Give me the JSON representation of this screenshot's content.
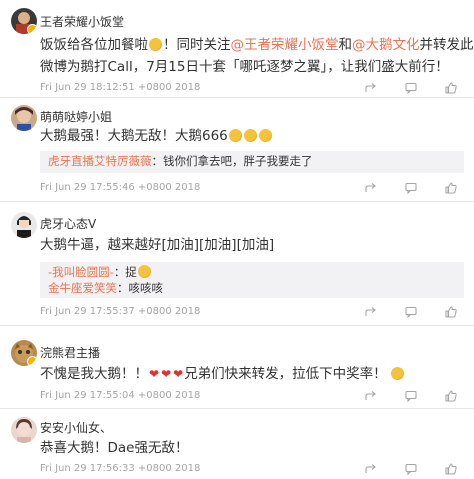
{
  "comments": [
    {
      "username": "王者荣耀小饭堂",
      "line1_a": "饭饭给各位加餐啦",
      "line1_b": "！同时关注",
      "mention1": "@王者荣耀小饭堂",
      "line1_c": "和",
      "mention2": "@大鹅文化",
      "line1_d": "并转发此",
      "line2": "微博为鹅打Call，7月15日十套「哪吒逐梦之翼」，让我们盛大前行！",
      "timestamp": "Fri Jun 29 18:12:51 +0800 2018"
    },
    {
      "username": "萌萌哒婷小姐",
      "content": "大鹅最强！大鹅无敌！大鹅666",
      "timestamp": "Fri Jun 29 17:55:46 +0800 2018",
      "replies": [
        {
          "user": "虎牙直播艾特厉薇薇",
          "text": "：钱你们拿去吧，胖子我要走了"
        }
      ]
    },
    {
      "username": "虎牙心态V",
      "content": "大鹅牛逼，越来越好[加油][加油][加油]",
      "timestamp": "Fri Jun 29 17:55:37 +0800 2018",
      "replies": [
        {
          "user": "-我叫脸圆圆-",
          "text": "：捉"
        },
        {
          "user": "金牛座爱笑笑",
          "text": "：咳咳咳"
        }
      ]
    },
    {
      "username": "浣熊君主播",
      "content_a": "不愧是我大鹅！！",
      "content_b": "兄弟们快来转发，拉低下中奖率！",
      "timestamp": "Fri Jun 29 17:55:04 +0800 2018"
    },
    {
      "username": "安安小仙女、",
      "content": "恭喜大鹅！Dae强无敌！",
      "timestamp": "Fri Jun 29 17:56:33 +0800 2018"
    }
  ],
  "icons": [
    "forward-icon",
    "comment-icon",
    "like-icon"
  ]
}
